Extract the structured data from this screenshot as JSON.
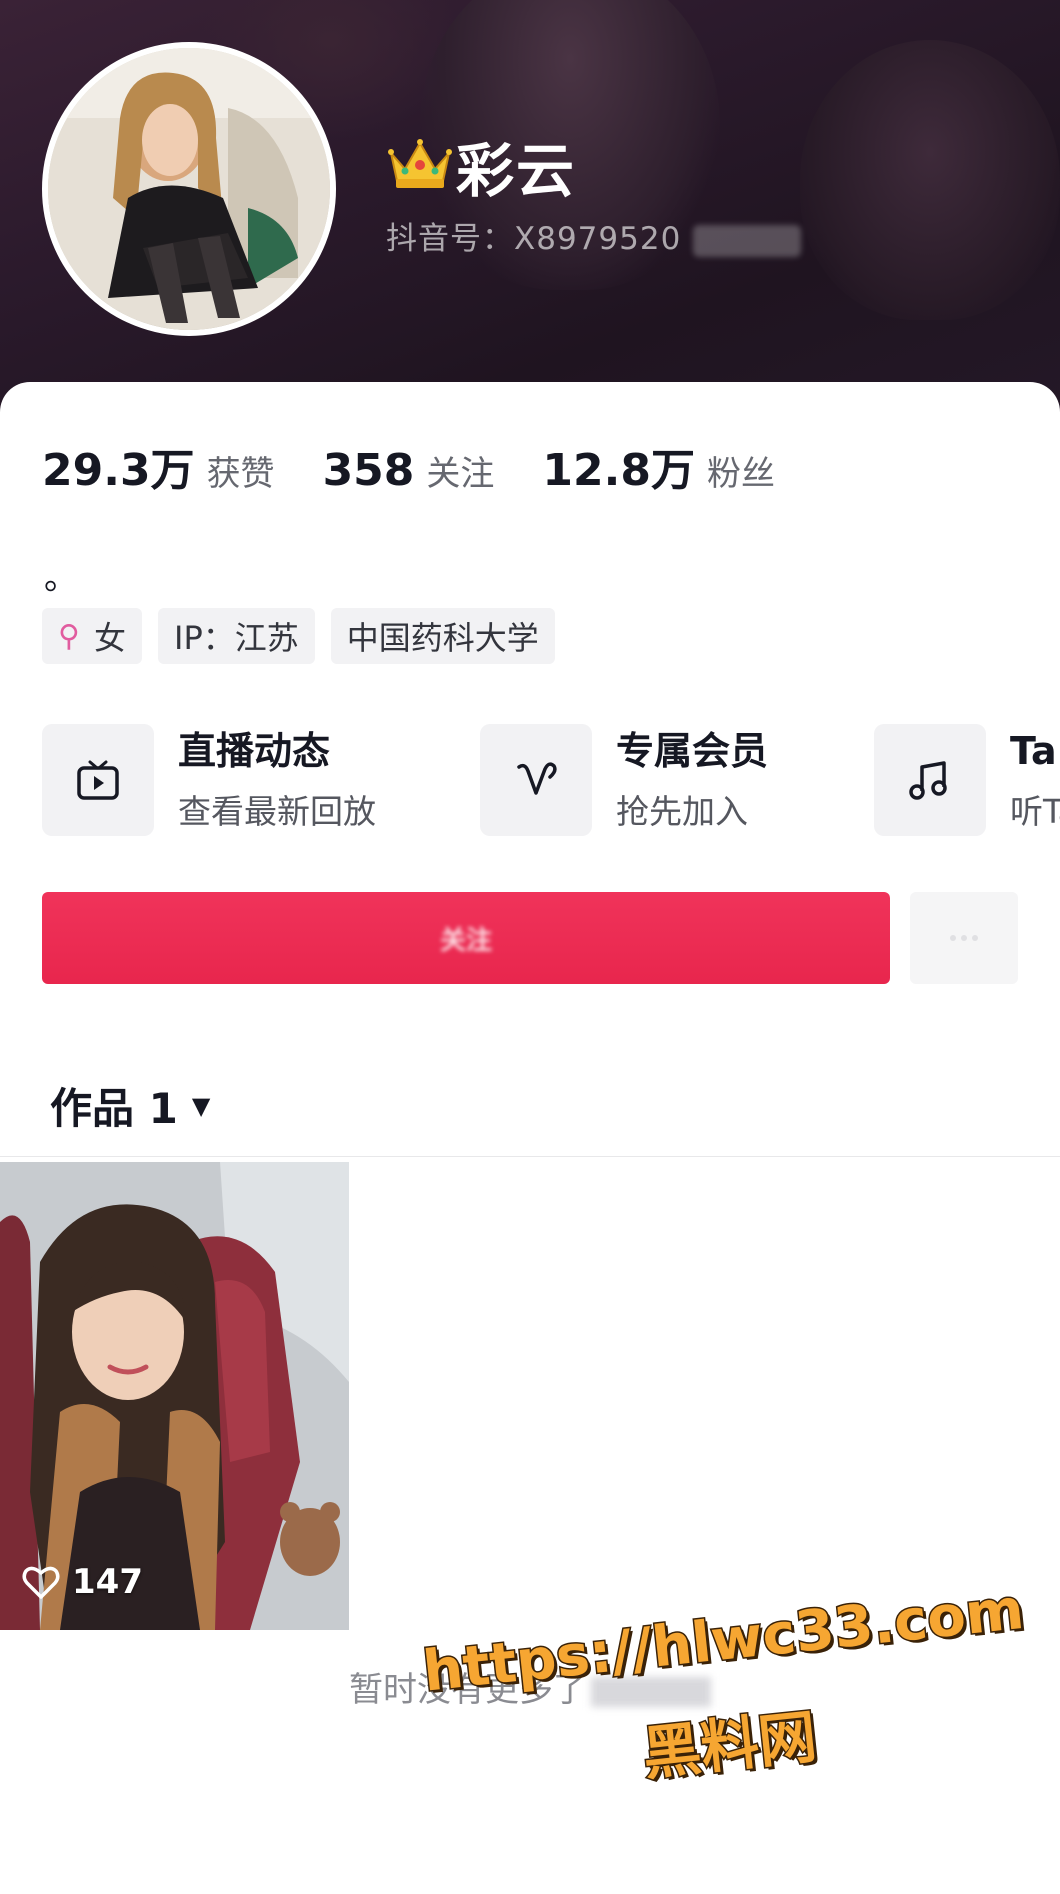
{
  "profile": {
    "nickname": "彩云",
    "crown_icon": "crown-icon",
    "douyin_id": "抖音号：X8979520"
  },
  "stats": [
    {
      "value": "29.3万",
      "label": "获赞"
    },
    {
      "value": "358",
      "label": "关注"
    },
    {
      "value": "12.8万",
      "label": "粉丝"
    }
  ],
  "bio": "。",
  "tags": {
    "gender": "女",
    "gender_icon": "female-icon",
    "ip": "IP：江苏",
    "school": "中国药科大学"
  },
  "features": [
    {
      "icon": "tv-play-icon",
      "title": "直播动态",
      "subtitle": "查看最新回放"
    },
    {
      "icon": "heart-v-icon",
      "title": "专属会员",
      "subtitle": "抢先加入"
    },
    {
      "icon": "music-note-icon",
      "title": "Ta",
      "subtitle": "听Ta"
    }
  ],
  "actions": {
    "follow_label": "关注"
  },
  "works": {
    "tab_label": "作品 1",
    "caret_icon": "caret-down-icon"
  },
  "video": {
    "likes": "147",
    "like_icon": "heart-outline-icon"
  },
  "end_text": "暂时没有更多了",
  "watermark": {
    "line1": "https://hlwc33.com",
    "line2": "黑料网"
  },
  "colors": {
    "accent": "#e8264d",
    "header_bg": "#2b1a2c",
    "watermark": "#f6a632"
  }
}
